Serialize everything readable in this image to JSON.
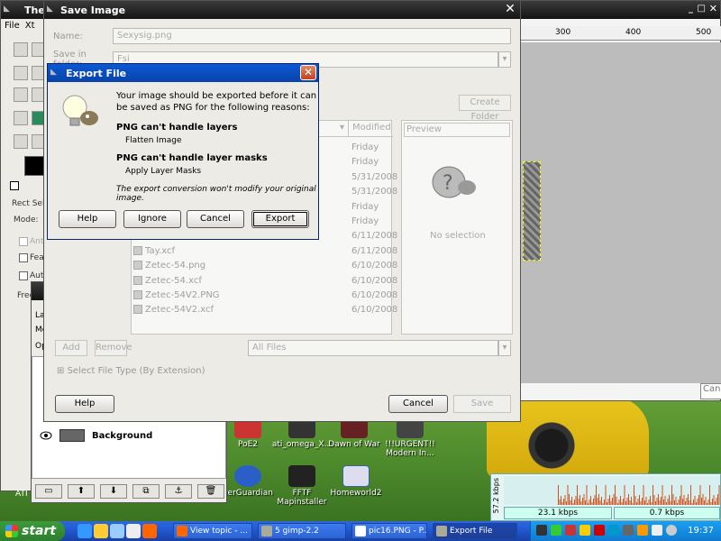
{
  "colors": {
    "xp_blue": "#245edb",
    "gimp_title": "#141414",
    "xp_green": "#2d7f2d"
  },
  "toolbox": {
    "title": "The",
    "menu": [
      "File",
      "Xt"
    ],
    "tool_option_label": "Rect Sele",
    "mode_label": "Mode:",
    "antialias_label": "Anti",
    "feather_label": "Fea",
    "auto_label": "Auto",
    "fixed_label": "Free",
    "bottom_label": "ATI"
  },
  "layers": {
    "labels": [
      "La",
      "Mo",
      "Op"
    ],
    "layer_name": "Background",
    "buttons": [
      "new-layer-icon",
      "raise-icon",
      "lower-icon",
      "duplicate-icon",
      "anchor-icon",
      "delete-icon"
    ]
  },
  "canvas": {
    "ruler": [
      "300",
      "400",
      "500"
    ],
    "canc_text": "Canc"
  },
  "save_dialog": {
    "title": "Save Image",
    "name_label": "Name:",
    "name_value": "Sexysig.png",
    "folder_label": "Save in folder:",
    "folder_value": "Fsi",
    "create_folder": "Create Folder",
    "col_modified": "Modified",
    "preview_label": "Preview",
    "no_selection": "No selection",
    "files": [
      {
        "name": "",
        "date": "Friday"
      },
      {
        "name": "",
        "date": "Friday"
      },
      {
        "name": "",
        "date": "5/31/2008"
      },
      {
        "name": "",
        "date": "5/31/2008"
      },
      {
        "name": "",
        "date": "Friday"
      },
      {
        "name": "",
        "date": "Friday"
      },
      {
        "name": "",
        "date": "6/11/2008"
      },
      {
        "name": "Tay.xcf",
        "date": "6/11/2008"
      },
      {
        "name": "Zetec-54.png",
        "date": "6/10/2008"
      },
      {
        "name": "Zetec-54.xcf",
        "date": "6/10/2008"
      },
      {
        "name": "Zetec-54V2.PNG",
        "date": "6/10/2008"
      },
      {
        "name": "Zetec-54V2.xcf",
        "date": "6/10/2008"
      }
    ],
    "add": "Add",
    "remove": "Remove",
    "filter": "All Files",
    "select_type": "Select File Type (By Extension)",
    "help": "Help",
    "cancel": "Cancel",
    "save": "Save"
  },
  "export_dialog": {
    "title": "Export File",
    "intro_line1": "Your image should be exported before it can",
    "intro_line2": "be saved as PNG for the following reasons:",
    "reason1_title": "PNG can't handle layers",
    "reason1_fix": "Flatten Image",
    "reason2_title": "PNG can't handle layer masks",
    "reason2_fix": "Apply Layer Masks",
    "note": "The export conversion won't modify your original image.",
    "help": "Help",
    "ignore": "Ignore",
    "cancel": "Cancel",
    "export": "Export"
  },
  "desktop_icons": [
    {
      "label": "PoE2"
    },
    {
      "label": "ati_omega_X..."
    },
    {
      "label": "Dawn of War"
    },
    {
      "label": "!!!URGENT!! Modern In..."
    },
    {
      "label": "eerGuardian"
    },
    {
      "label": "FFTF Mapinstaller"
    },
    {
      "label": "Homeworld2"
    }
  ],
  "netmeter": {
    "scale": "57.2 kbps",
    "down": "23.1 kbps",
    "up": "0.7 kbps"
  },
  "taskbar": {
    "start": "start",
    "tasks": [
      "View topic - ...",
      "gimp-2.2",
      "pic16.PNG - P...",
      "Export File"
    ],
    "gimp_count": "5",
    "clock": "19:37"
  }
}
